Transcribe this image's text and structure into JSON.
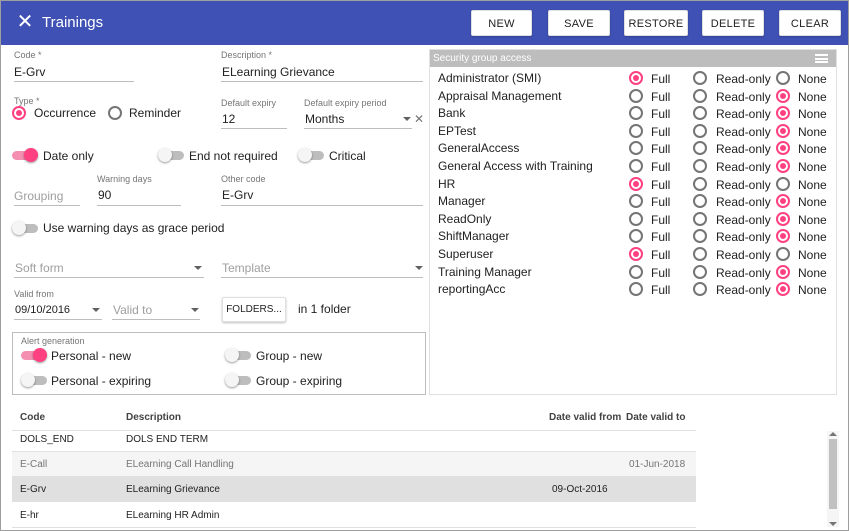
{
  "window": {
    "title": "Trainings",
    "close_icon": "close-icon"
  },
  "toolbar": {
    "new": "NEW",
    "save": "SAVE",
    "restore": "RESTORE",
    "delete": "DELETE",
    "clear": "CLEAR"
  },
  "form": {
    "code": {
      "label": "Code *",
      "value": "E-Grv"
    },
    "description": {
      "label": "Description *",
      "value": "ELearning Grievance"
    },
    "type": {
      "label": "Type *",
      "options": [
        "Occurrence",
        "Reminder"
      ],
      "selected": "Occurrence"
    },
    "default_expiry": {
      "label": "Default expiry",
      "value": "12"
    },
    "default_expiry_period": {
      "label": "Default expiry period",
      "value": "Months"
    },
    "date_only": {
      "label": "Date only",
      "on": true
    },
    "end_not_required": {
      "label": "End not required",
      "on": false
    },
    "critical": {
      "label": "Critical",
      "on": false
    },
    "grouping": {
      "placeholder": "Grouping",
      "value": ""
    },
    "warning_days": {
      "label": "Warning days",
      "value": "90"
    },
    "other_code": {
      "label": "Other code",
      "value": "E-Grv"
    },
    "grace": {
      "label": "Use warning days as grace period",
      "on": false
    },
    "soft_form": {
      "placeholder": "Soft form"
    },
    "template": {
      "placeholder": "Template"
    },
    "valid_from": {
      "label": "Valid from",
      "value": "09/10/2016"
    },
    "valid_to": {
      "placeholder": "Valid to"
    },
    "folders": {
      "button": "FOLDERS...",
      "count_text": "in 1 folder"
    }
  },
  "alert": {
    "label": "Alert generation",
    "personal_new": {
      "label": "Personal - new",
      "on": true
    },
    "personal_expiring": {
      "label": "Personal - expiring",
      "on": false
    },
    "group_new": {
      "label": "Group - new",
      "on": false
    },
    "group_expiring": {
      "label": "Group - expiring",
      "on": false
    }
  },
  "security": {
    "header": "Security group access",
    "options": [
      "Full",
      "Read-only",
      "None"
    ],
    "groups": [
      {
        "name": "Administrator (SMI)",
        "access": "Full"
      },
      {
        "name": "Appraisal Management",
        "access": "None"
      },
      {
        "name": "Bank",
        "access": "None"
      },
      {
        "name": "EPTest",
        "access": "None"
      },
      {
        "name": "GeneralAccess",
        "access": "None"
      },
      {
        "name": "General Access with Training",
        "access": "None"
      },
      {
        "name": "HR",
        "access": "Full"
      },
      {
        "name": "Manager",
        "access": "None"
      },
      {
        "name": "ReadOnly",
        "access": "None"
      },
      {
        "name": "ShiftManager",
        "access": "None"
      },
      {
        "name": "Superuser",
        "access": "Full"
      },
      {
        "name": "Training Manager",
        "access": "None"
      },
      {
        "name": "reportingAcc",
        "access": "None"
      }
    ]
  },
  "table": {
    "columns": [
      "Code",
      "Description",
      "Date valid from",
      "Date valid to"
    ],
    "rows": [
      {
        "code": "DOLS_END",
        "description": "DOLS END TERM",
        "from": "",
        "to": "",
        "muted": false,
        "selected": false
      },
      {
        "code": "E-Call",
        "description": "ELearning Call Handling",
        "from": "",
        "to": "01-Jun-2018",
        "muted": true,
        "selected": false
      },
      {
        "code": "E-Grv",
        "description": "ELearning Grievance",
        "from": "09-Oct-2016",
        "to": "",
        "muted": false,
        "selected": true
      },
      {
        "code": "E-hr",
        "description": "ELearning HR Admin",
        "from": "",
        "to": "",
        "muted": false,
        "selected": false
      }
    ]
  },
  "colors": {
    "primary": "#3f51b5",
    "accent": "#ff4081",
    "selected_row": "#e0e0e0",
    "muted_row": "#f5f5f5"
  }
}
